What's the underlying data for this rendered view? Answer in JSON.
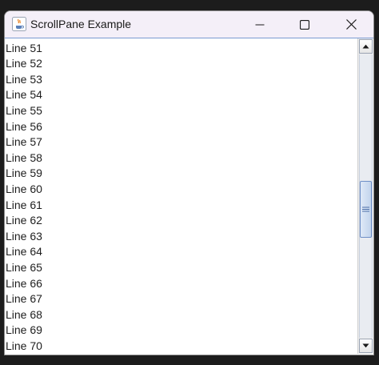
{
  "window": {
    "title": "ScrollPane Example",
    "controls": {
      "minimize_icon": "minimize-icon",
      "maximize_icon": "maximize-icon",
      "close_icon": "close-icon"
    }
  },
  "lines": [
    "Line 51",
    "Line 52",
    "Line 53",
    "Line 54",
    "Line 55",
    "Line 56",
    "Line 57",
    "Line 58",
    "Line 59",
    "Line 60",
    "Line 61",
    "Line 62",
    "Line 63",
    "Line 64",
    "Line 65",
    "Line 66",
    "Line 67",
    "Line 68",
    "Line 69",
    "Line 70"
  ],
  "scrollbar": {
    "position_fraction": 0.56,
    "visible_fraction": 0.2
  },
  "colors": {
    "titlebar_bg": "#f4eff8",
    "accent_border": "#6e8fc7"
  }
}
